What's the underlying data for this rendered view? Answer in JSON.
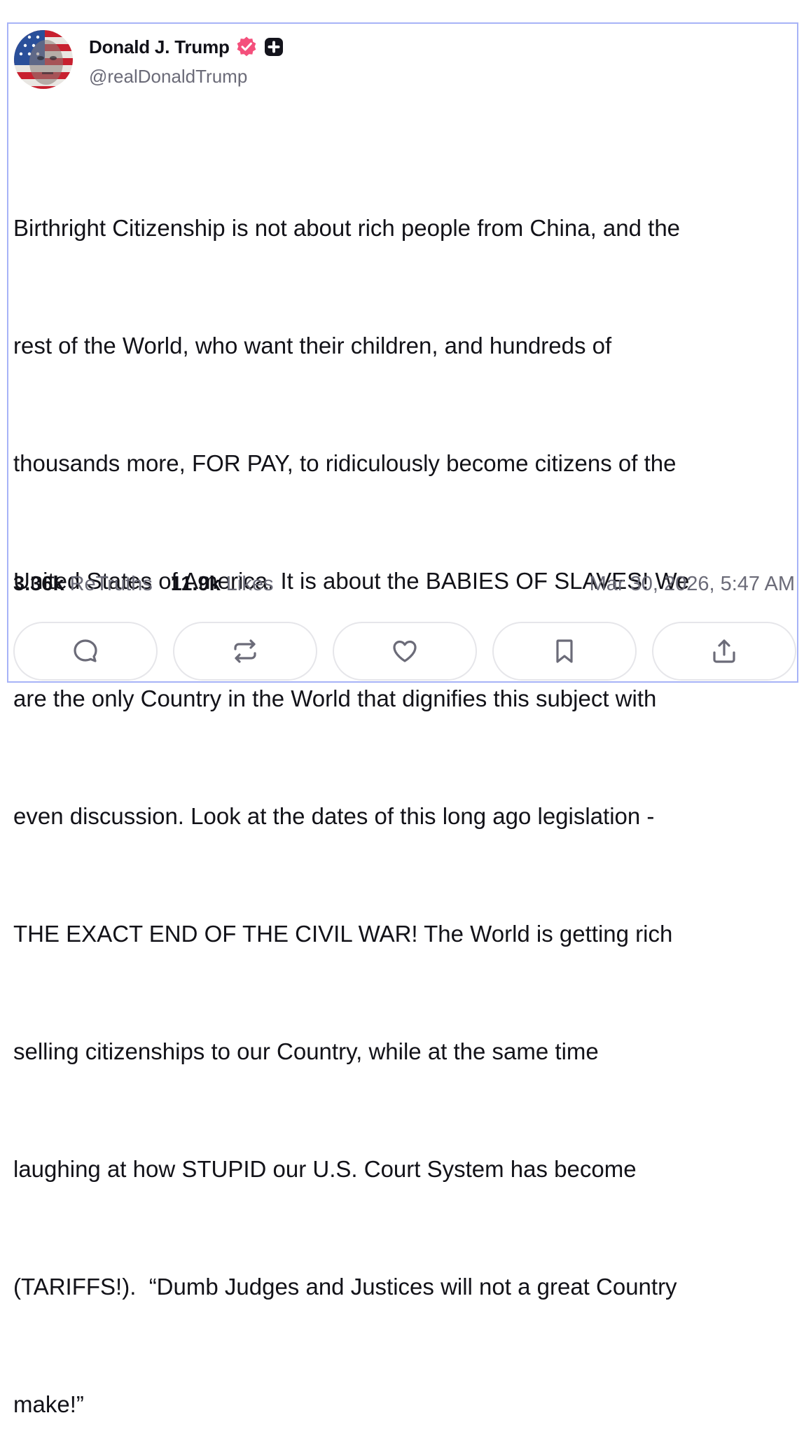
{
  "author": {
    "display_name": "Donald J. Trump",
    "handle": "@realDonaldTrump",
    "avatar": "avatar-flag-portrait",
    "verified_badge_color": "#f4507c",
    "verified_icon": "verified-badge-icon",
    "plus_icon": "plus-badge-icon"
  },
  "post": {
    "lines": [
      "Birthright Citizenship is not about rich people from China, and the",
      "rest of the World, who want their children, and hundreds of",
      "thousands more, FOR PAY, to ridiculously become citizens of the",
      "United States of America. It is about the BABIES OF SLAVES! We",
      "are the only Country in the World that dignifies this subject with",
      "even discussion. Look at the dates of this long ago legislation -",
      "THE EXACT END OF THE CIVIL WAR! The World is getting rich",
      "selling citizenships to our Country, while at the same time",
      "laughing at how STUPID our U.S. Court System has become",
      "(TARIFFS!).  “Dumb Judges and Justices will not a great Country",
      "make!”"
    ]
  },
  "stats": {
    "retruths_count": "3.36k",
    "retruths_label": "ReTruths",
    "likes_count": "11.9k",
    "likes_label": "Likes",
    "timestamp": "Mar 30, 2026, 5:47 AM"
  },
  "actions": [
    {
      "name": "reply",
      "icon": "comment-icon"
    },
    {
      "name": "retruth",
      "icon": "repost-icon"
    },
    {
      "name": "like",
      "icon": "heart-icon"
    },
    {
      "name": "bookmark",
      "icon": "bookmark-icon"
    },
    {
      "name": "share",
      "icon": "share-icon"
    }
  ],
  "colors": {
    "card_border": "#a7b3f7",
    "muted_text": "#6b6b78",
    "button_border": "#e6e6ea",
    "icon_stroke": "#6b6b78"
  }
}
